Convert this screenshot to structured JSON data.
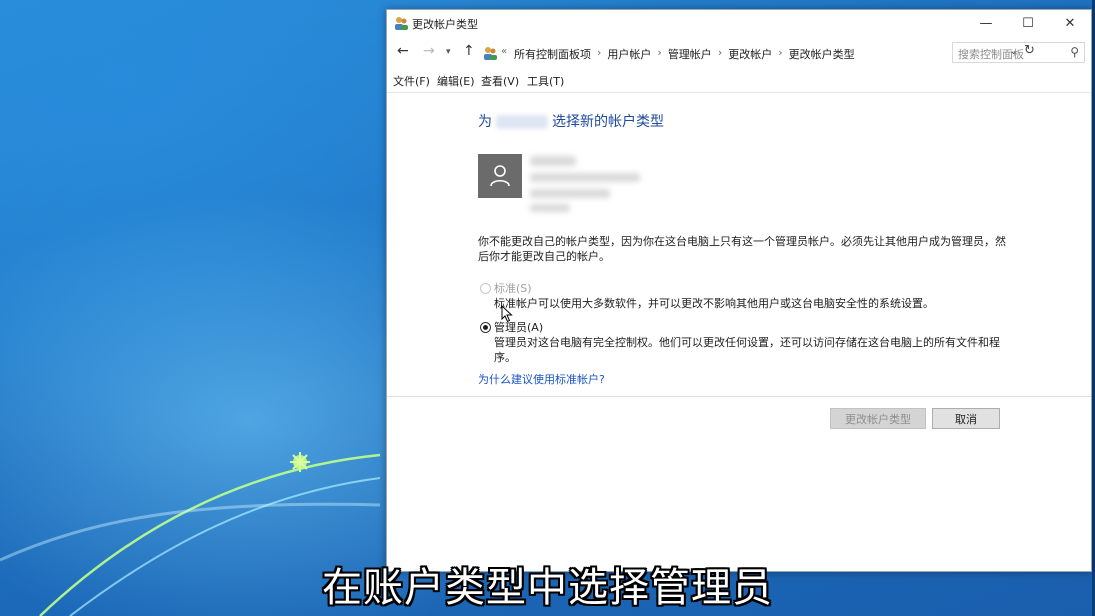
{
  "window": {
    "title": "更改帐户类型",
    "controls": {
      "minimize": "—",
      "maximize": "☐",
      "close": "✕"
    }
  },
  "address": {
    "separator": "›",
    "crumbs": [
      "所有控制面板项",
      "用户帐户",
      "管理帐户",
      "更改帐户",
      "更改帐户类型"
    ],
    "search_placeholder": "搜索控制面板"
  },
  "menu": [
    "文件(F)",
    "编辑(E)",
    "查看(V)",
    "工具(T)"
  ],
  "content": {
    "heading_prefix": "为",
    "heading_suffix": "选择新的帐户类型",
    "notice": "你不能更改自己的帐户类型，因为你在这台电脑上只有这一个管理员帐户。必须先让其他用户成为管理员，然后你才能更改自己的帐户。",
    "options": [
      {
        "label": "标准(S)",
        "description": "标准帐户可以使用大多数软件，并可以更改不影响其他用户或这台电脑安全性的系统设置。",
        "selected": false,
        "disabled": true
      },
      {
        "label": "管理员(A)",
        "description": "管理员对这台电脑有完全控制权。他们可以更改任何设置，还可以访问存储在这台电脑上的所有文件和程序。",
        "selected": true,
        "disabled": false
      }
    ],
    "help_link": "为什么建议使用标准帐户?"
  },
  "buttons": {
    "change": "更改帐户类型",
    "cancel": "取消"
  },
  "subtitle": "在账户类型中选择管理员",
  "colors": {
    "heading": "#1e4a9e",
    "link": "#1a56c4",
    "desktop": "#1f78c8"
  }
}
